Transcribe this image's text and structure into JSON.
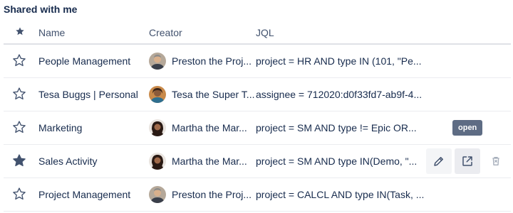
{
  "section_title": "Shared with me",
  "columns": {
    "star": "star-icon",
    "name": "Name",
    "creator": "Creator",
    "jql": "JQL"
  },
  "rows": [
    {
      "starred": false,
      "name": "People Management",
      "creator": "Preston the Proj...",
      "jql": "project = HR AND type IN (101, \"Pe..."
    },
    {
      "starred": false,
      "name": "Tesa Buggs | Personal",
      "creator": "Tesa the Super T...",
      "jql": "assignee = 712020:d0f33fd7-ab9f-4..."
    },
    {
      "starred": false,
      "name": "Marketing",
      "creator": "Martha the Mar...",
      "jql": "project = SM AND type != Epic OR..."
    },
    {
      "starred": true,
      "name": "Sales Activity",
      "creator": "Martha the Mar...",
      "jql": "project = SM AND type IN(Demo, \"..."
    },
    {
      "starred": false,
      "name": "Project Management",
      "creator": "Preston the Proj...",
      "jql": "project = CALCL AND type IN(Task, ..."
    }
  ],
  "row_actions": {
    "edit_icon": "pencil-icon",
    "open_icon": "open-in-new-icon",
    "delete_icon": "trash-icon"
  },
  "tooltip": "open",
  "colors": {
    "star_outline": "#42526e",
    "star_filled": "#42526e",
    "tooltip_bg": "#5e6c84",
    "divider": "#dfe1e6"
  }
}
